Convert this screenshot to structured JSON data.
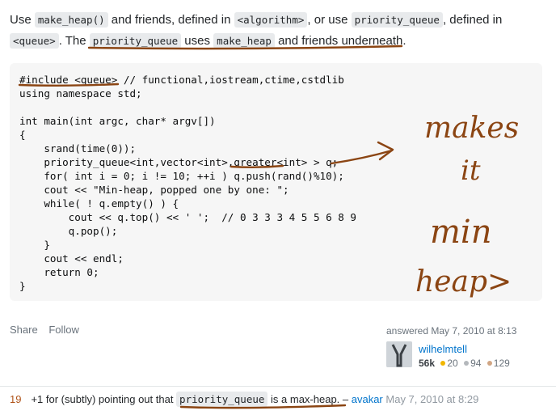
{
  "intro": {
    "t1": "Use ",
    "c1": "make_heap()",
    "t2": " and friends, defined in ",
    "c2": "<algorithm>",
    "t3": ", or use ",
    "c3": "priority_queue",
    "t4": ", defined in ",
    "c4": "<queue>",
    "t5": ". The ",
    "c5": "priority_queue",
    "t6": " uses ",
    "c6": "make_heap",
    "t7": " and friends underneath."
  },
  "code": [
    "#include <queue> // functional,iostream,ctime,cstdlib",
    "using namespace std;",
    "",
    "int main(int argc, char* argv[])",
    "{",
    "    srand(time(0));",
    "    priority_queue<int,vector<int>,greater<int> > q;",
    "    for( int i = 0; i != 10; ++i ) q.push(rand()%10);",
    "    cout << \"Min-heap, popped one by one: \";",
    "    while( ! q.empty() ) {",
    "        cout << q.top() << ' ';  // 0 3 3 3 4 5 5 6 8 9",
    "        q.pop();",
    "    }",
    "    cout << endl;",
    "    return 0;",
    "}"
  ],
  "post_actions": {
    "share": "Share",
    "follow": "Follow"
  },
  "user_card": {
    "answered": "answered May 7, 2010 at 8:13",
    "username": "wilhelmtell",
    "reputation": "56k",
    "gold": "20",
    "silver": "94",
    "bronze": "129",
    "colors": {
      "gold": "#f1b600",
      "silver": "#b4b8bc",
      "bronze": "#d1a684"
    }
  },
  "comment": {
    "score": "19",
    "text_before": "+1 for (subtly) pointing out that ",
    "code": "priority_queue",
    "text_after": " is a max-heap. – ",
    "author": "avakar",
    "date": "May 7, 2010 at 8:29"
  },
  "handwriting": {
    "color": "#8b4513",
    "note_lines": [
      "makes",
      "it",
      "min",
      "heap>"
    ]
  }
}
